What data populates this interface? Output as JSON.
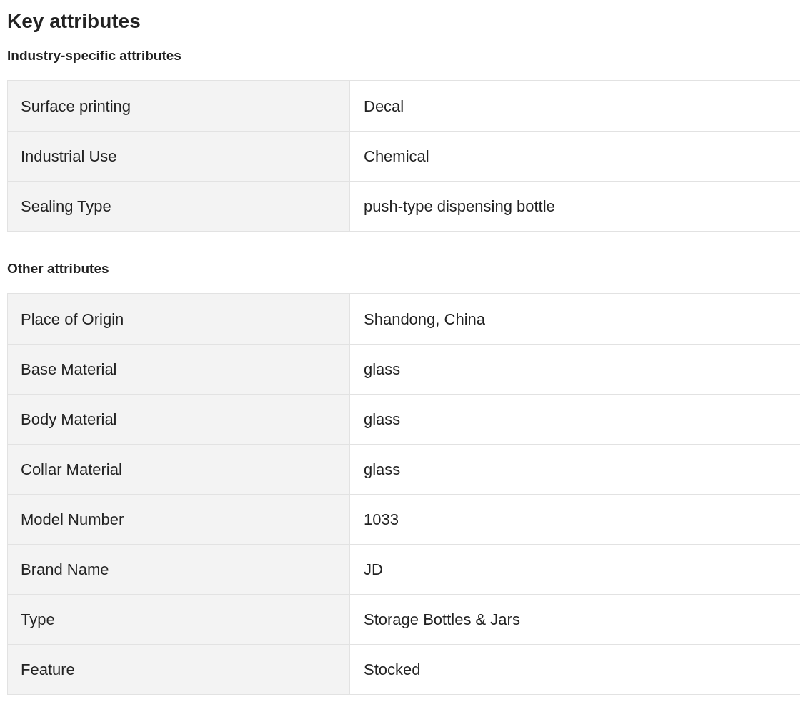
{
  "title": "Key attributes",
  "sections": [
    {
      "heading": "Industry-specific attributes",
      "rows": [
        {
          "label": "Surface printing",
          "value": "Decal"
        },
        {
          "label": "Industrial Use",
          "value": "Chemical"
        },
        {
          "label": "Sealing Type",
          "value": "push-type dispensing bottle"
        }
      ]
    },
    {
      "heading": "Other attributes",
      "rows": [
        {
          "label": "Place of Origin",
          "value": "Shandong, China"
        },
        {
          "label": "Base Material",
          "value": "glass"
        },
        {
          "label": "Body Material",
          "value": "glass"
        },
        {
          "label": "Collar Material",
          "value": "glass"
        },
        {
          "label": "Model Number",
          "value": "1033"
        },
        {
          "label": "Brand Name",
          "value": "JD"
        },
        {
          "label": "Type",
          "value": "Storage Bottles & Jars"
        },
        {
          "label": "Feature",
          "value": "Stocked"
        }
      ]
    }
  ]
}
